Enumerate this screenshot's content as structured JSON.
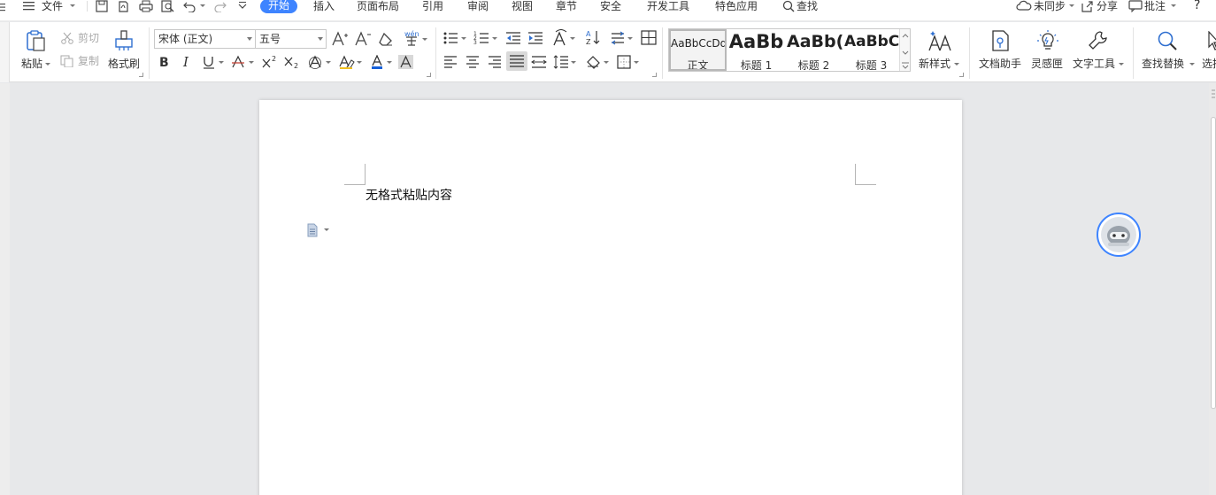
{
  "menubar": {
    "file_label": "文件",
    "tabs": [
      "开始",
      "插入",
      "页面布局",
      "引用",
      "审阅",
      "视图",
      "章节",
      "安全",
      "开发工具",
      "特色应用"
    ],
    "search_label": "查找",
    "sync_label": "未同步",
    "share_label": "分享",
    "comment_label": "批注",
    "help_label": "?"
  },
  "clipboard": {
    "paste_label": "粘贴",
    "cut_label": "剪切",
    "copy_label": "复制",
    "format_painter_label": "格式刷"
  },
  "font": {
    "family_value": "宋体 (正文)",
    "size_value": "五号",
    "phonetic_label": "wén"
  },
  "styles": {
    "items": [
      {
        "preview": "AaBbCcDd",
        "name": "正文"
      },
      {
        "preview": "AaBb",
        "name": "标题 1"
      },
      {
        "preview": "AaBb(",
        "name": "标题 2"
      },
      {
        "preview": "AaBbC",
        "name": "标题 3"
      }
    ],
    "new_style_label": "新样式"
  },
  "tools": {
    "doc_assistant_label": "文档助手",
    "inspiration_label": "灵感匣",
    "text_tools_label": "文字工具",
    "find_replace_label": "查找替换",
    "select_label": "选择"
  },
  "document": {
    "body_text": "无格式粘贴内容"
  },
  "colors": {
    "accent": "#3e84ff",
    "font_color": "#1560d9",
    "highlight": "#f0c020"
  }
}
